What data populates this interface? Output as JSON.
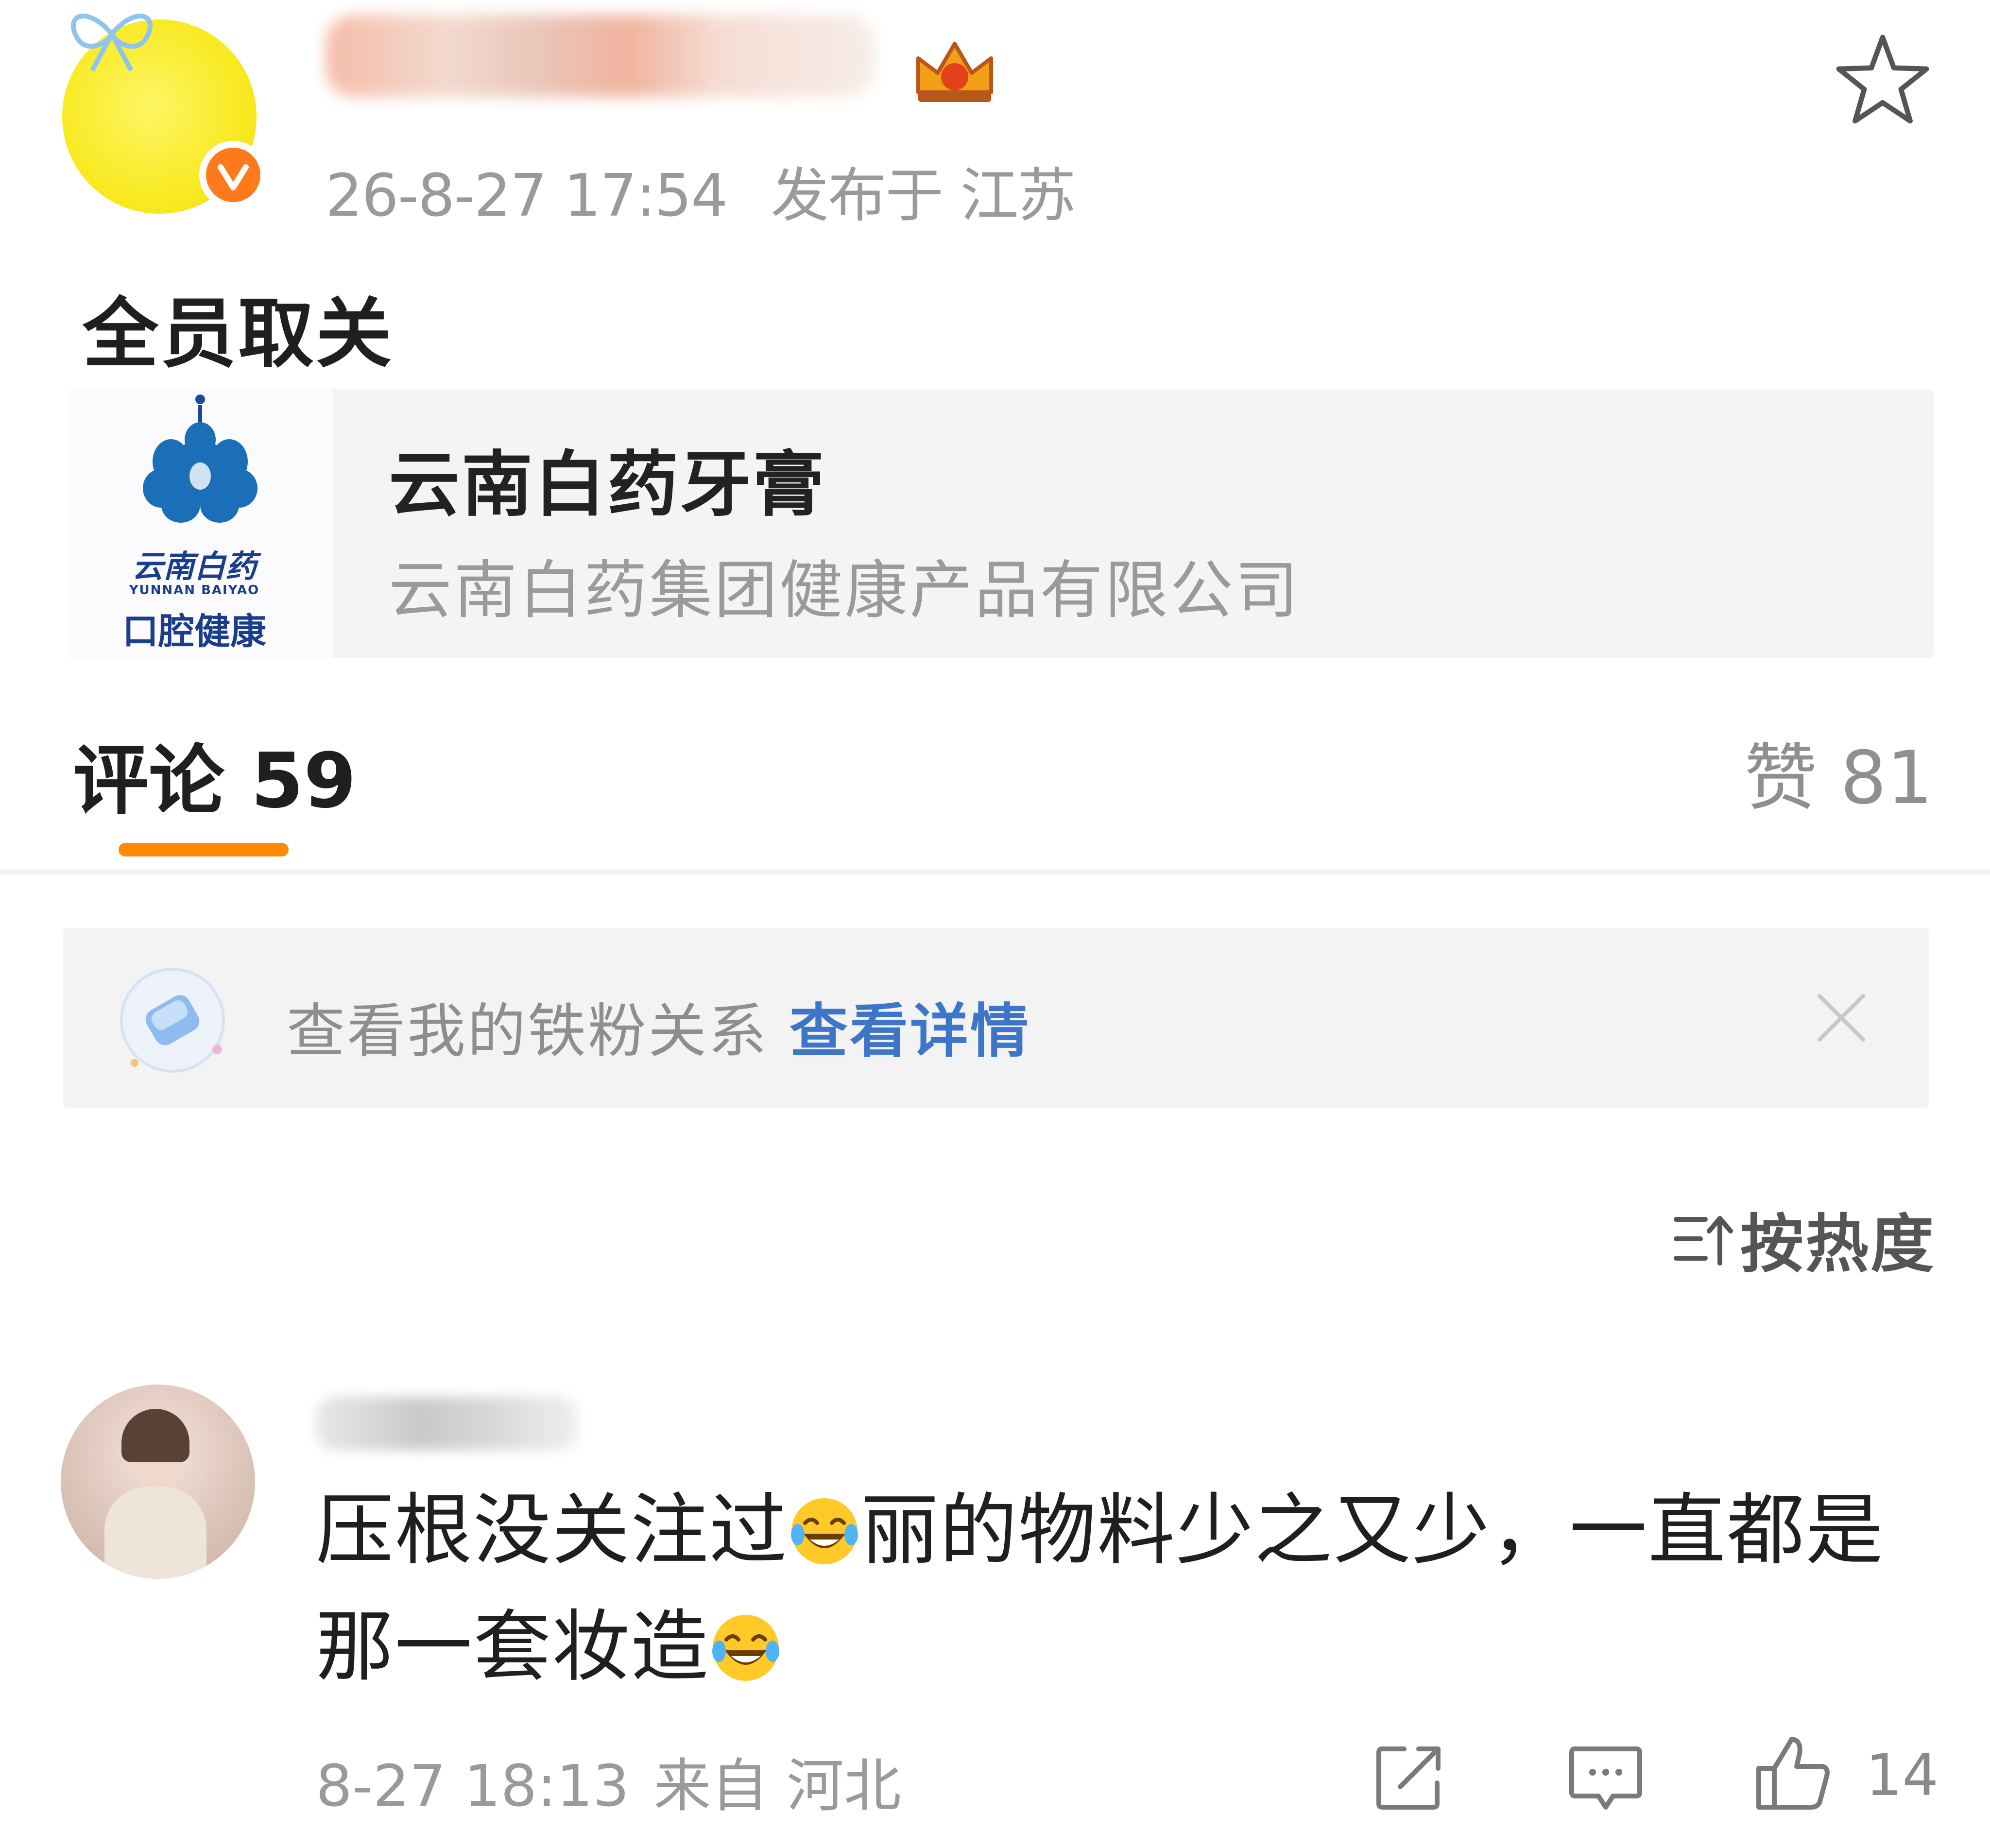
{
  "post": {
    "timestamp": "26-8-27 17:54",
    "location": "发布于 江苏",
    "text": "全员取关",
    "avatar_icon": "yellow-avatar",
    "verified_icon": "verified-badge-icon",
    "star_icon": "star-icon"
  },
  "product_card": {
    "title": "云南白药牙膏",
    "company": "云南白药集团健康产品有限公司",
    "logo": {
      "calligraphy": "云南白药",
      "latin": "YUNNAN BAIYAO",
      "subtitle": "口腔健康"
    }
  },
  "tabs": {
    "comments_label": "评论 59",
    "likes_label": "赞 81",
    "accent_color": "#ff8a00"
  },
  "fan_banner": {
    "text": "查看我的铁粉关系",
    "link": "查看详情",
    "link_color": "#3d76c8"
  },
  "sort": {
    "label": "按热度"
  },
  "comment": {
    "text_part1": "压根没关注过",
    "text_part2": "丽的物料少之又少，一直都是那一套妆造",
    "emoji_icon": "laughing-crying-emoji",
    "time": "8-27 18:13",
    "location": "来自 河北",
    "like_count": "14"
  }
}
